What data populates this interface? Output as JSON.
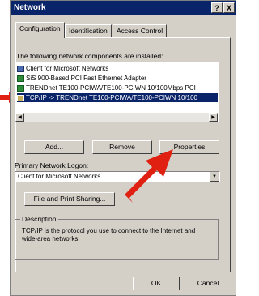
{
  "window": {
    "title": "Network",
    "help_btn": "?",
    "close_btn": "X"
  },
  "tabs": [
    {
      "label": "Configuration",
      "active": true
    },
    {
      "label": "Identification",
      "active": false
    },
    {
      "label": "Access Control",
      "active": false
    }
  ],
  "components_label": "The following network components are installed:",
  "components": [
    {
      "label": "Client for Microsoft Networks",
      "icon": "client-icon"
    },
    {
      "label": "SiS 900-Based PCI Fast Ethernet Adapter",
      "icon": "network-adapter-icon"
    },
    {
      "label": "TRENDnet TE100-PCIWA/TE100-PCIWN 10/100Mbps PCI",
      "icon": "network-adapter-icon"
    },
    {
      "label": "TCP/IP -> TRENDnet TE100-PCIWA/TE100-PCIWN 10/100",
      "icon": "protocol-icon",
      "selected": true
    }
  ],
  "buttons": {
    "add": "Add...",
    "remove": "Remove",
    "properties": "Properties"
  },
  "primary_logon_label": "Primary Network Logon:",
  "primary_logon_value": "Client for Microsoft Networks",
  "file_print_sharing": "File and Print Sharing...",
  "description": {
    "title": "Description",
    "text": "TCP/IP is the protocol you use to connect to the Internet and wide-area networks."
  },
  "footer": {
    "ok": "OK",
    "cancel": "Cancel"
  },
  "colors": {
    "selection": "#0a246a",
    "annotation_arrow": "#e02010",
    "dialog_bg": "#d4d0c8"
  }
}
